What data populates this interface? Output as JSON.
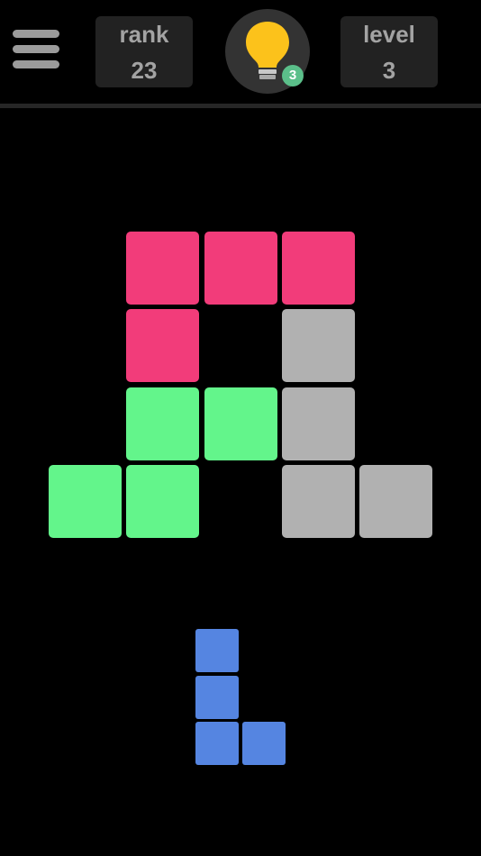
{
  "header": {
    "menu_icon": "hamburger-menu-icon",
    "rank": {
      "label": "rank",
      "value": "23"
    },
    "hint": {
      "icon": "lightbulb-icon",
      "count": "3",
      "badge_color": "#5bbf8a"
    },
    "level": {
      "label": "level",
      "value": "3"
    }
  },
  "colors": {
    "background": "#000000",
    "panel": "#222222",
    "pink": "#f23c7a",
    "green": "#63f58b",
    "gray": "#b1b1b1",
    "blue": "#5585e1"
  },
  "board": {
    "pieces": [
      {
        "color": "pink",
        "cells": [
          [
            0,
            1
          ],
          [
            0,
            2
          ],
          [
            0,
            3
          ],
          [
            1,
            1
          ]
        ]
      },
      {
        "color": "gray",
        "cells": [
          [
            1,
            3
          ],
          [
            2,
            3
          ],
          [
            3,
            3
          ],
          [
            3,
            4
          ]
        ]
      },
      {
        "color": "green",
        "cells": [
          [
            2,
            1
          ],
          [
            2,
            2
          ],
          [
            3,
            0
          ],
          [
            3,
            1
          ]
        ]
      }
    ]
  },
  "tray": {
    "piece": {
      "color": "blue",
      "cells": [
        [
          0,
          0
        ],
        [
          1,
          0
        ],
        [
          2,
          0
        ],
        [
          2,
          1
        ]
      ]
    }
  }
}
